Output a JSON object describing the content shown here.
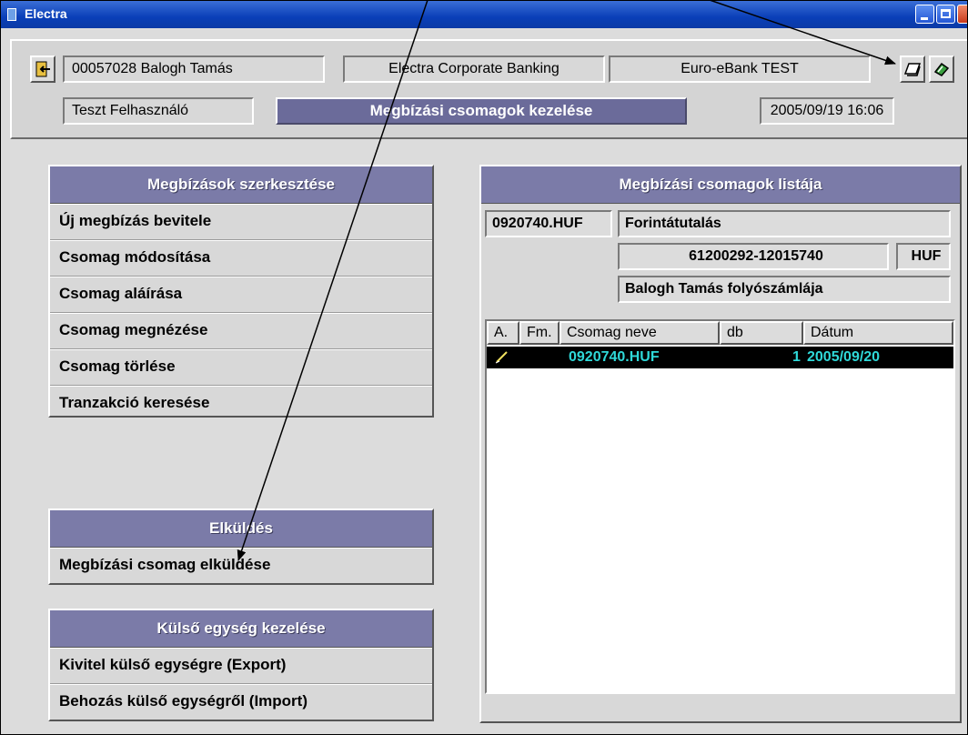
{
  "window": {
    "title": "Electra"
  },
  "header": {
    "user_id": "00057028 Balogh Tamás",
    "app_name": "Electra Corporate Banking",
    "env_name": "Euro-eBank TEST",
    "user_role": "Teszt Felhasználó",
    "screen_title": "Megbízási csomagok kezelése",
    "datetime": "2005/09/19 16:06"
  },
  "edit_panel": {
    "title": "Megbízások szerkesztése",
    "items": [
      {
        "label": "Új megbízás bevitele"
      },
      {
        "label": "Csomag módosítása"
      },
      {
        "label": "Csomag aláírása"
      },
      {
        "label": "Csomag megnézése"
      },
      {
        "label": "Csomag törlése"
      },
      {
        "label": "Tranzakció keresése"
      }
    ]
  },
  "send_panel": {
    "title": "Elküldés",
    "items": [
      {
        "label": "Megbízási csomag elküldése"
      }
    ]
  },
  "external_panel": {
    "title": "Külső egység kezelése",
    "items": [
      {
        "label": "Kivitel külső egységre (Export)"
      },
      {
        "label": "Behozás külső egységről (Import)"
      }
    ]
  },
  "list_panel": {
    "title": "Megbízási csomagok listája",
    "package_file": "0920740.HUF",
    "transfer_type": "Forintátutalás",
    "account_number": "61200292-12015740",
    "currency": "HUF",
    "account_name": "Balogh Tamás folyószámlája",
    "columns": [
      "A.",
      "Fm.",
      "Csomag neve",
      "db",
      "Dátum"
    ],
    "rows": [
      {
        "icon": "pen-icon",
        "name": "0920740.HUF",
        "count": "1",
        "date": "2005/09/20"
      }
    ]
  }
}
